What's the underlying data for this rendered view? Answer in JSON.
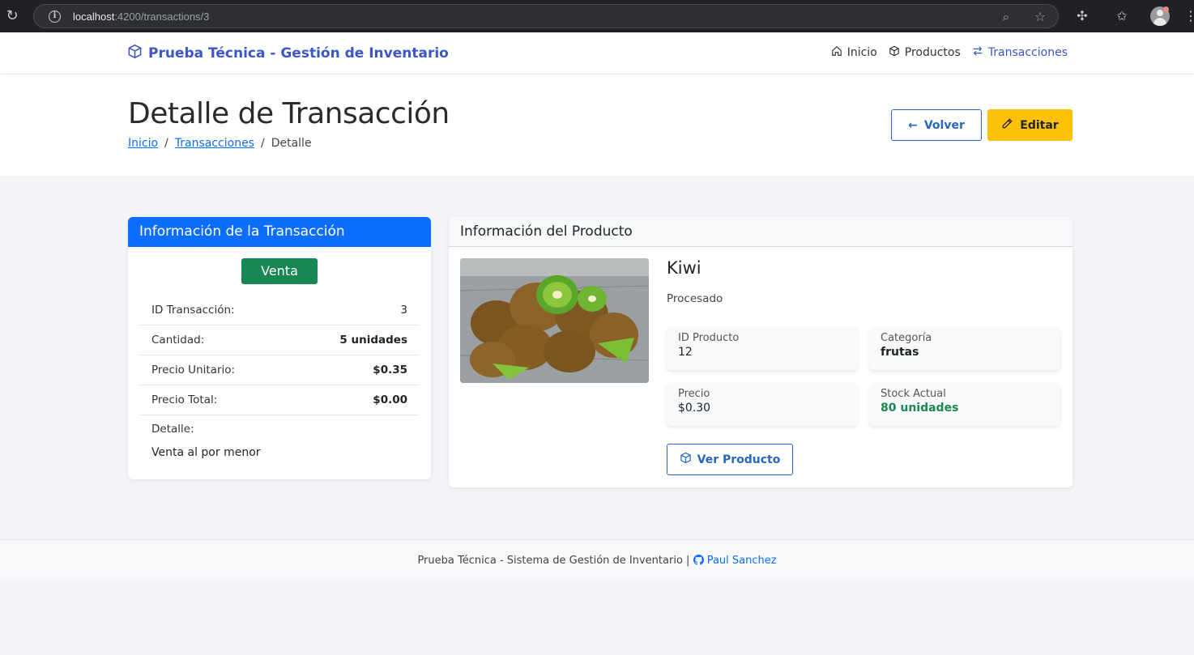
{
  "browser": {
    "url_host": "localhost",
    "url_path": ":4200/transactions/3"
  },
  "navbar": {
    "brand": "Prueba Técnica - Gestión de Inventario",
    "links": [
      {
        "label": "Inicio",
        "icon": "home-icon"
      },
      {
        "label": "Productos",
        "icon": "box-icon"
      },
      {
        "label": "Transacciones",
        "icon": "arrows-icon",
        "active": true
      }
    ]
  },
  "header": {
    "title": "Detalle de Transacción",
    "breadcrumb": [
      "Inicio",
      "Transacciones",
      "Detalle"
    ],
    "back_label": "Volver",
    "edit_label": "Editar"
  },
  "transaction": {
    "card_title": "Información de la Transacción",
    "type_badge": "Venta",
    "rows": [
      {
        "label": "ID Transacción:",
        "value": "3"
      },
      {
        "label": "Cantidad:",
        "value": "5 unidades"
      },
      {
        "label": "Precio Unitario:",
        "value": "$0.35"
      },
      {
        "label": "Precio Total:",
        "value": "$0.00"
      }
    ],
    "detail_label": "Detalle:",
    "detail_text": "Venta al por menor"
  },
  "product": {
    "card_title": "Información del Producto",
    "name": "Kiwi",
    "description": "Procesado",
    "stats": [
      {
        "label": "ID Producto",
        "value": "12"
      },
      {
        "label": "Categoría",
        "value": "frutas"
      },
      {
        "label": "Precio",
        "value": "$0.30"
      },
      {
        "label": "Stock Actual",
        "value": "80 unidades"
      }
    ],
    "view_label": "Ver Producto"
  },
  "footer": {
    "text": "Prueba Técnica - Sistema de Gestión de Inventario |",
    "author": "Paul Sanchez"
  },
  "colors": {
    "primary": "#0d6efd",
    "brand": "#3a56c8",
    "success": "#198754",
    "warning": "#ffc107"
  }
}
